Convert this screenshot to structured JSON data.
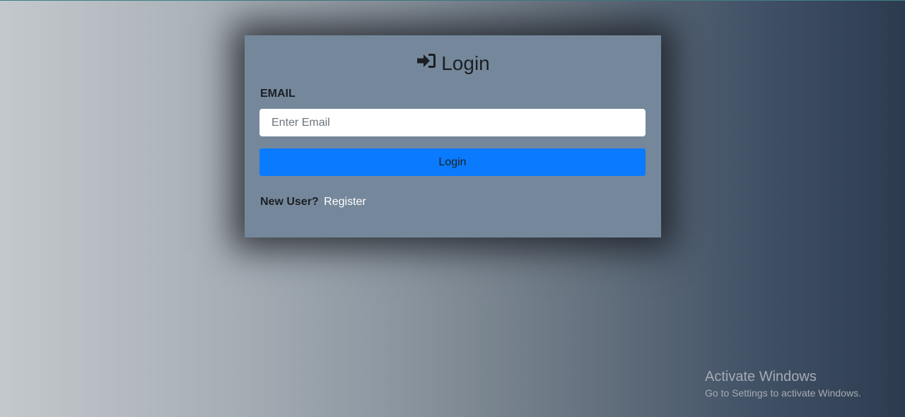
{
  "login_card": {
    "icon": "sign-in-icon",
    "title": "Login",
    "email_label": "EMAIL",
    "email_placeholder": "Enter Email",
    "email_value": "",
    "login_button": "Login",
    "new_user_text": "New User?",
    "register_link": "Register"
  },
  "watermark": {
    "title": "Activate Windows",
    "subtitle": "Go to Settings to activate Windows."
  },
  "colors": {
    "card_background": "#75889b",
    "login_button": "#0a7bff",
    "register_link": "#ffffff"
  }
}
